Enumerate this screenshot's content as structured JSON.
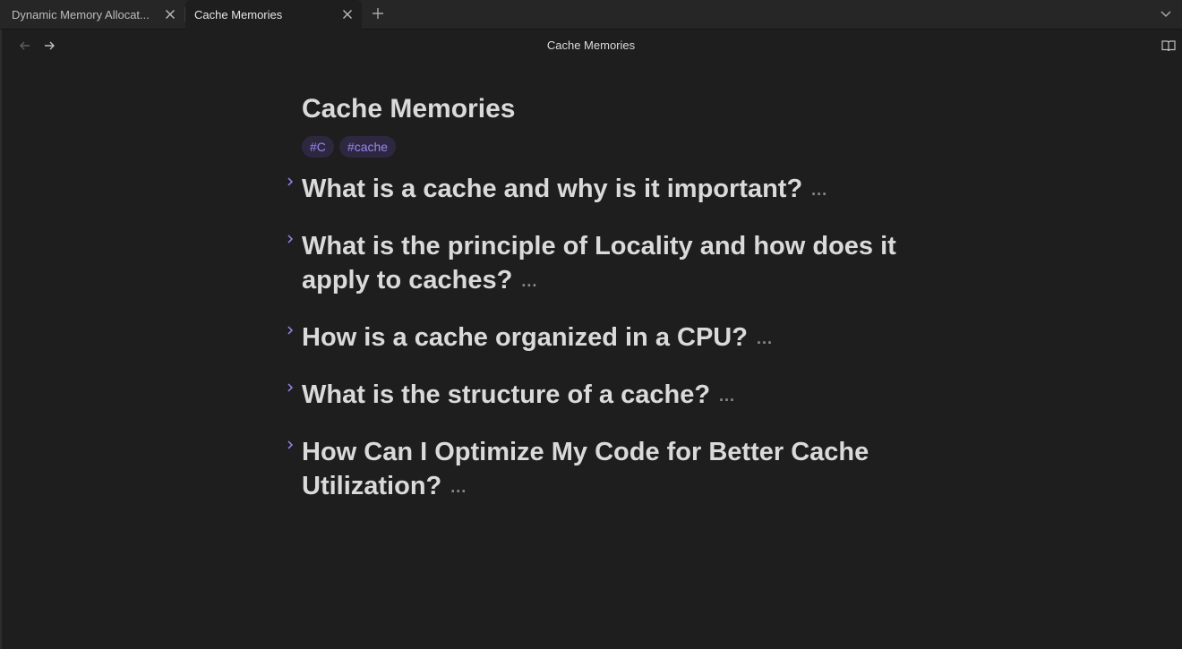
{
  "tabs": [
    {
      "title": "Dynamic Memory Allocat...",
      "active": false
    },
    {
      "title": "Cache Memories",
      "active": true
    }
  ],
  "nav": {
    "view_title": "Cache Memories"
  },
  "note": {
    "title": "Cache Memories",
    "tags": [
      "#C",
      "#cache"
    ],
    "headings": [
      "What is a cache and why is it important?",
      "What is the principle of Locality and how does it apply to caches?",
      "How is a cache organized in a CPU?",
      "What is the structure of a cache?",
      "How Can I Optimize My Code for Better Cache Utilization?"
    ],
    "collapsed_indicator": "..."
  },
  "colors": {
    "background": "#1e1e1e",
    "tabbar": "#262626",
    "accent": "#9a86f0",
    "text": "#dadada"
  },
  "icons": {
    "tab_close": "close-icon",
    "new_tab": "plus-icon",
    "tab_list": "chevron-down-icon",
    "back": "arrow-left-icon",
    "forward": "arrow-right-icon",
    "reading_mode": "book-open-icon",
    "fold": "chevron-right-icon"
  }
}
